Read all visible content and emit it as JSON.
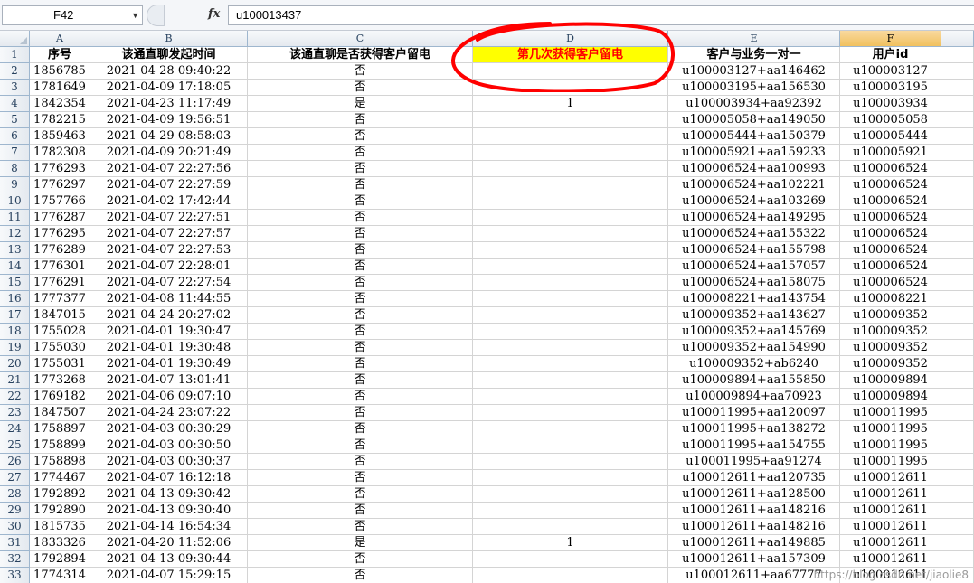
{
  "formula_bar": {
    "name_box": "F42",
    "fx_label": "fx",
    "formula": "u100013437"
  },
  "columns": [
    "A",
    "B",
    "C",
    "D",
    "E",
    "F"
  ],
  "active_column": "F",
  "headers": [
    "序号",
    "该通直聊发起时间",
    "该通直聊是否获得客户留电",
    "第几次获得客户留电",
    "客户与业务一对一",
    "用户id"
  ],
  "rows": [
    [
      "1856785",
      "2021-04-28 09:40:22",
      "否",
      "",
      "u100003127+aa146462",
      "u100003127"
    ],
    [
      "1781649",
      "2021-04-09 17:18:05",
      "否",
      "",
      "u100003195+aa156530",
      "u100003195"
    ],
    [
      "1842354",
      "2021-04-23 11:17:49",
      "是",
      "1",
      "u100003934+aa92392",
      "u100003934"
    ],
    [
      "1782215",
      "2021-04-09 19:56:51",
      "否",
      "",
      "u100005058+aa149050",
      "u100005058"
    ],
    [
      "1859463",
      "2021-04-29 08:58:03",
      "否",
      "",
      "u100005444+aa150379",
      "u100005444"
    ],
    [
      "1782308",
      "2021-04-09 20:21:49",
      "否",
      "",
      "u100005921+aa159233",
      "u100005921"
    ],
    [
      "1776293",
      "2021-04-07 22:27:56",
      "否",
      "",
      "u100006524+aa100993",
      "u100006524"
    ],
    [
      "1776297",
      "2021-04-07 22:27:59",
      "否",
      "",
      "u100006524+aa102221",
      "u100006524"
    ],
    [
      "1757766",
      "2021-04-02 17:42:44",
      "否",
      "",
      "u100006524+aa103269",
      "u100006524"
    ],
    [
      "1776287",
      "2021-04-07 22:27:51",
      "否",
      "",
      "u100006524+aa149295",
      "u100006524"
    ],
    [
      "1776295",
      "2021-04-07 22:27:57",
      "否",
      "",
      "u100006524+aa155322",
      "u100006524"
    ],
    [
      "1776289",
      "2021-04-07 22:27:53",
      "否",
      "",
      "u100006524+aa155798",
      "u100006524"
    ],
    [
      "1776301",
      "2021-04-07 22:28:01",
      "否",
      "",
      "u100006524+aa157057",
      "u100006524"
    ],
    [
      "1776291",
      "2021-04-07 22:27:54",
      "否",
      "",
      "u100006524+aa158075",
      "u100006524"
    ],
    [
      "1777377",
      "2021-04-08 11:44:55",
      "否",
      "",
      "u100008221+aa143754",
      "u100008221"
    ],
    [
      "1847015",
      "2021-04-24 20:27:02",
      "否",
      "",
      "u100009352+aa143627",
      "u100009352"
    ],
    [
      "1755028",
      "2021-04-01 19:30:47",
      "否",
      "",
      "u100009352+aa145769",
      "u100009352"
    ],
    [
      "1755030",
      "2021-04-01 19:30:48",
      "否",
      "",
      "u100009352+aa154990",
      "u100009352"
    ],
    [
      "1755031",
      "2021-04-01 19:30:49",
      "否",
      "",
      "u100009352+ab6240",
      "u100009352"
    ],
    [
      "1773268",
      "2021-04-07 13:01:41",
      "否",
      "",
      "u100009894+aa155850",
      "u100009894"
    ],
    [
      "1769182",
      "2021-04-06 09:07:10",
      "否",
      "",
      "u100009894+aa70923",
      "u100009894"
    ],
    [
      "1847507",
      "2021-04-24 23:07:22",
      "否",
      "",
      "u100011995+aa120097",
      "u100011995"
    ],
    [
      "1758897",
      "2021-04-03 00:30:29",
      "否",
      "",
      "u100011995+aa138272",
      "u100011995"
    ],
    [
      "1758899",
      "2021-04-03 00:30:50",
      "否",
      "",
      "u100011995+aa154755",
      "u100011995"
    ],
    [
      "1758898",
      "2021-04-03 00:30:37",
      "否",
      "",
      "u100011995+aa91274",
      "u100011995"
    ],
    [
      "1774467",
      "2021-04-07 16:12:18",
      "否",
      "",
      "u100012611+aa120735",
      "u100012611"
    ],
    [
      "1792892",
      "2021-04-13 09:30:42",
      "否",
      "",
      "u100012611+aa128500",
      "u100012611"
    ],
    [
      "1792890",
      "2021-04-13 09:30:40",
      "否",
      "",
      "u100012611+aa148216",
      "u100012611"
    ],
    [
      "1815735",
      "2021-04-14 16:54:34",
      "否",
      "",
      "u100012611+aa148216",
      "u100012611"
    ],
    [
      "1833326",
      "2021-04-20 11:52:06",
      "是",
      "1",
      "u100012611+aa149885",
      "u100012611"
    ],
    [
      "1792894",
      "2021-04-13 09:30:44",
      "否",
      "",
      "u100012611+aa157309",
      "u100012611"
    ],
    [
      "1774314",
      "2021-04-07 15:29:15",
      "否",
      "",
      "u100012611+aa67777",
      "u100012611"
    ]
  ],
  "colors": {
    "highlight_fill": "#ffff00",
    "highlight_text": "#ff0000",
    "annotation": "#ff0000"
  }
}
